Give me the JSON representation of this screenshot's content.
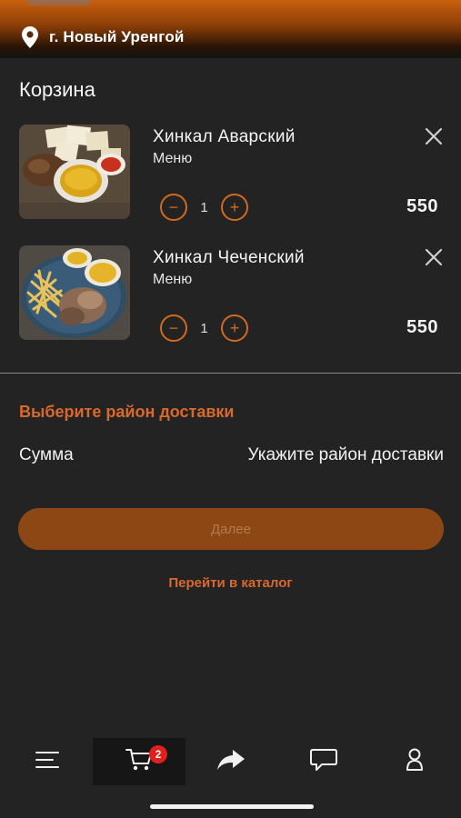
{
  "header": {
    "location": "г. Новый Уренгой",
    "location_icon": "map-pin-icon"
  },
  "page": {
    "title": "Корзина"
  },
  "cart": {
    "items": [
      {
        "name": "Хинкал Аварский",
        "category": "Меню",
        "quantity": "1",
        "price": "550",
        "image": "khinkal-avar-dish-photo"
      },
      {
        "name": "Хинкал Чеченский",
        "category": "Меню",
        "quantity": "1",
        "price": "550",
        "image": "khinkal-chechen-dish-photo"
      }
    ],
    "decrement_symbol": "−",
    "increment_symbol": "+"
  },
  "delivery": {
    "choose_district": "Выберите район доставки",
    "sum_label": "Сумма",
    "sum_value": "Укажите район доставки"
  },
  "actions": {
    "next": "Далее",
    "catalog": "Перейти в каталог"
  },
  "tabbar": {
    "items": [
      {
        "name": "menu",
        "icon": "menu-lines-icon"
      },
      {
        "name": "cart",
        "icon": "cart-icon",
        "badge": "2",
        "active": true
      },
      {
        "name": "share",
        "icon": "share-arrow-icon"
      },
      {
        "name": "chat",
        "icon": "chat-bubble-icon"
      },
      {
        "name": "profile",
        "icon": "profile-icon"
      }
    ]
  },
  "colors": {
    "accent": "#d9692a",
    "button_bg": "#8c4714",
    "background": "#232323",
    "badge": "#e0201c"
  }
}
